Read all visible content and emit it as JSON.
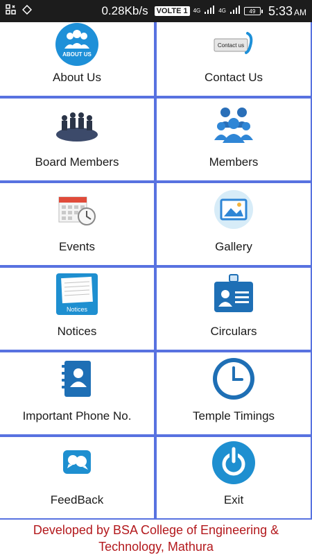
{
  "status_bar": {
    "speed": "0.28Kb/s",
    "volte": "VOLTE 1",
    "network1": "4G",
    "network2": "4G",
    "battery": "49",
    "time": "5:33",
    "ampm": "AM"
  },
  "menu": [
    {
      "label": "About Us",
      "icon": "about-us-icon"
    },
    {
      "label": "Contact Us",
      "icon": "contact-us-icon"
    },
    {
      "label": "Board Members",
      "icon": "board-members-icon"
    },
    {
      "label": "Members",
      "icon": "members-icon"
    },
    {
      "label": "Events",
      "icon": "calendar-clock-icon"
    },
    {
      "label": "Gallery",
      "icon": "gallery-icon"
    },
    {
      "label": "Notices",
      "icon": "notices-icon"
    },
    {
      "label": "Circulars",
      "icon": "id-card-icon"
    },
    {
      "label": "Important Phone No.",
      "icon": "phone-book-icon"
    },
    {
      "label": "Temple Timings",
      "icon": "clock-icon"
    },
    {
      "label": "FeedBack",
      "icon": "feedback-icon"
    },
    {
      "label": "Exit",
      "icon": "power-icon"
    }
  ],
  "icon_text": {
    "about_us": "ABOUT US",
    "contact_us": "Contact us",
    "notices": "Notices"
  },
  "footer": {
    "text": "Developed by BSA College of Engineering & Technology, Mathura"
  },
  "colors": {
    "grid_line": "#5872e0",
    "footer_text": "#b3181c",
    "status_bar": "#1c1c1c"
  }
}
